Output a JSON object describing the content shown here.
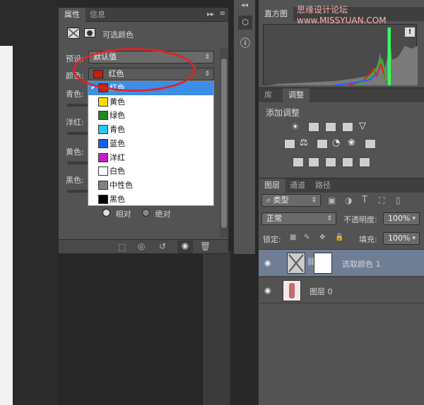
{
  "watermark": "思缘设计论坛  www.MISSYUAN.COM",
  "properties": {
    "tabs": [
      "属性",
      "信息"
    ],
    "title": "可选颜色",
    "preset_label": "预设:",
    "preset_value": "默认值",
    "color_label": "颜色:",
    "color_value": "红色",
    "sliders": [
      "青色:",
      "洋红:",
      "黄色:",
      "黑色:"
    ],
    "dropdown": [
      {
        "label": "红色",
        "color": "#c8200a",
        "selected": true
      },
      {
        "label": "黄色",
        "color": "#f5e000",
        "selected": false
      },
      {
        "label": "绿色",
        "color": "#1f8a1f",
        "selected": false
      },
      {
        "label": "青色",
        "color": "#27c8f0",
        "selected": false
      },
      {
        "label": "蓝色",
        "color": "#1660e8",
        "selected": false
      },
      {
        "label": "洋红",
        "color": "#c81ec8",
        "selected": false
      },
      {
        "label": "白色",
        "color": "#ffffff",
        "selected": false
      },
      {
        "label": "中性色",
        "color": "#808080",
        "selected": false
      },
      {
        "label": "黑色",
        "color": "#000000",
        "selected": false
      }
    ],
    "radio_relative": "相对",
    "radio_absolute": "绝对"
  },
  "histogram": {
    "tab": "直方图"
  },
  "adjustments": {
    "tabs": [
      "库",
      "调整"
    ],
    "title": "添加调整"
  },
  "layers": {
    "tabs": [
      "图层",
      "通道",
      "路径"
    ],
    "filter_kind": "类型",
    "blend_mode": "正常",
    "opacity_label": "不透明度:",
    "opacity_value": "100%",
    "lock_label": "锁定:",
    "fill_label": "填充:",
    "fill_value": "100%",
    "items": [
      {
        "name": "选取颜色 1"
      },
      {
        "name": "图层 0"
      }
    ]
  }
}
